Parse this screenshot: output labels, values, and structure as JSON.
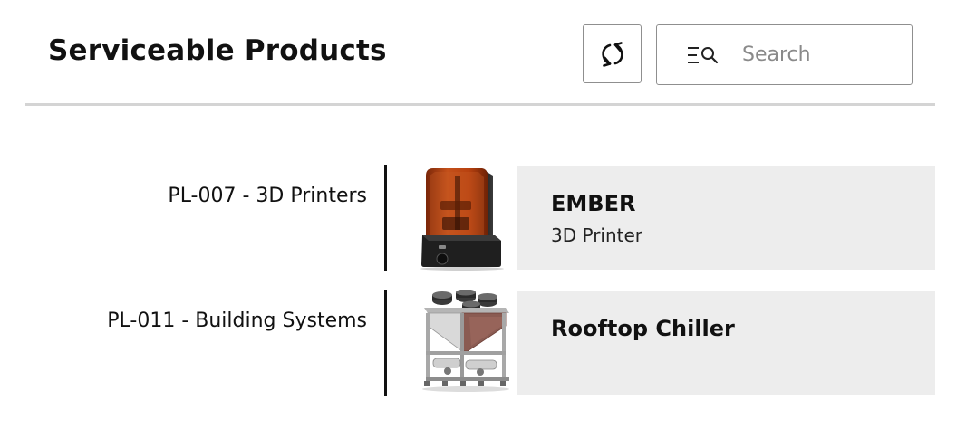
{
  "header": {
    "title": "Serviceable Products",
    "refresh_icon": "refresh-icon",
    "search_icon": "filter-search-icon",
    "search_placeholder": "Search",
    "search_value": ""
  },
  "groups": [
    {
      "label": "PL-007 - 3D Printers",
      "products": [
        {
          "name": "EMBER",
          "subtitle": "3D Printer",
          "image": "3d-printer-image"
        }
      ]
    },
    {
      "label": "PL-011 - Building Systems",
      "products": [
        {
          "name": "Rooftop Chiller",
          "subtitle": "",
          "image": "rooftop-chiller-image"
        }
      ]
    }
  ],
  "colors": {
    "card_background": "#ededed",
    "divider": "#d4d4d4",
    "group_bar": "#111111",
    "printer_lid": "#b8410f"
  }
}
